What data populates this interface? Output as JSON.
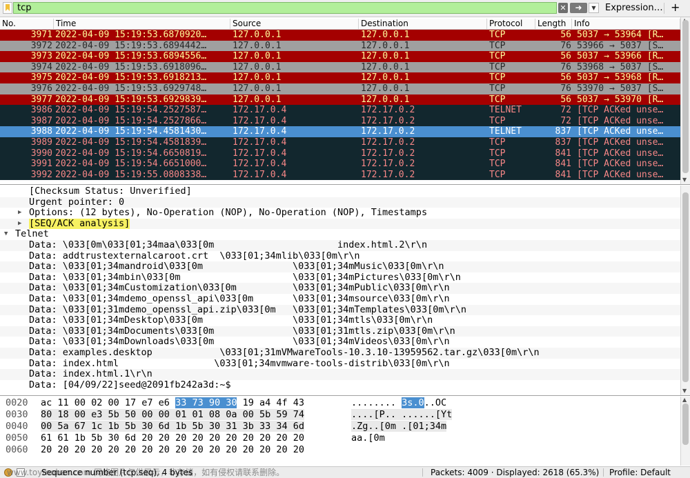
{
  "filter": {
    "value": "tcp",
    "expression_label": "Expression…",
    "add_label": "+",
    "clear_icon": "x-icon",
    "apply_icon": "arrow-right-icon"
  },
  "columns": [
    "No.",
    "Time",
    "Source",
    "Destination",
    "Protocol",
    "Length",
    "Info"
  ],
  "packets": [
    {
      "no": "3971",
      "time": "2022-04-09 15:19:53.6870920…",
      "src": "127.0.0.1",
      "dst": "127.0.0.1",
      "proto": "TCP",
      "len": "56",
      "info": "5037 → 53964 [R…",
      "style": "rst"
    },
    {
      "no": "3972",
      "time": "2022-04-09 15:19:53.6894442…",
      "src": "127.0.0.1",
      "dst": "127.0.0.1",
      "proto": "TCP",
      "len": "76",
      "info": "53966 → 5037 [S…",
      "style": "syn"
    },
    {
      "no": "3973",
      "time": "2022-04-09 15:19:53.6894556…",
      "src": "127.0.0.1",
      "dst": "127.0.0.1",
      "proto": "TCP",
      "len": "56",
      "info": "5037 → 53966 [R…",
      "style": "rst"
    },
    {
      "no": "3974",
      "time": "2022-04-09 15:19:53.6918096…",
      "src": "127.0.0.1",
      "dst": "127.0.0.1",
      "proto": "TCP",
      "len": "76",
      "info": "53968 → 5037 [S…",
      "style": "syn"
    },
    {
      "no": "3975",
      "time": "2022-04-09 15:19:53.6918213…",
      "src": "127.0.0.1",
      "dst": "127.0.0.1",
      "proto": "TCP",
      "len": "56",
      "info": "5037 → 53968 [R…",
      "style": "rst"
    },
    {
      "no": "3976",
      "time": "2022-04-09 15:19:53.6929748…",
      "src": "127.0.0.1",
      "dst": "127.0.0.1",
      "proto": "TCP",
      "len": "76",
      "info": "53970 → 5037 [S…",
      "style": "syn"
    },
    {
      "no": "3977",
      "time": "2022-04-09 15:19:53.6929839…",
      "src": "127.0.0.1",
      "dst": "127.0.0.1",
      "proto": "TCP",
      "len": "56",
      "info": "5037 → 53970 [R…",
      "style": "rst"
    },
    {
      "no": "3986",
      "time": "2022-04-09 15:19:54.2527587…",
      "src": "172.17.0.4",
      "dst": "172.17.0.2",
      "proto": "TELNET",
      "len": "72",
      "info": "[TCP ACKed unse…",
      "style": "dark"
    },
    {
      "no": "3987",
      "time": "2022-04-09 15:19:54.2527866…",
      "src": "172.17.0.4",
      "dst": "172.17.0.2",
      "proto": "TCP",
      "len": "72",
      "info": "[TCP ACKed unse…",
      "style": "dark"
    },
    {
      "no": "3988",
      "time": "2022-04-09 15:19:54.4581430…",
      "src": "172.17.0.4",
      "dst": "172.17.0.2",
      "proto": "TELNET",
      "len": "837",
      "info": "[TCP ACKed unse…",
      "style": "sel"
    },
    {
      "no": "3989",
      "time": "2022-04-09 15:19:54.4581839…",
      "src": "172.17.0.4",
      "dst": "172.17.0.2",
      "proto": "TCP",
      "len": "837",
      "info": "[TCP ACKed unse…",
      "style": "dark"
    },
    {
      "no": "3990",
      "time": "2022-04-09 15:19:54.6650819…",
      "src": "172.17.0.4",
      "dst": "172.17.0.2",
      "proto": "TCP",
      "len": "841",
      "info": "[TCP ACKed unse…",
      "style": "dark"
    },
    {
      "no": "3991",
      "time": "2022-04-09 15:19:54.6651000…",
      "src": "172.17.0.4",
      "dst": "172.17.0.2",
      "proto": "TCP",
      "len": "841",
      "info": "[TCP ACKed unse…",
      "style": "dark"
    },
    {
      "no": "3992",
      "time": "2022-04-09 15:19:55.0808338…",
      "src": "172.17.0.4",
      "dst": "172.17.0.2",
      "proto": "TCP",
      "len": "841",
      "info": "[TCP ACKed unse…",
      "style": "dark"
    }
  ],
  "details": [
    {
      "level": 2,
      "twisty": "",
      "text": "[Checksum Status: Unverified]",
      "hl": false
    },
    {
      "level": 2,
      "twisty": "",
      "text": "Urgent pointer: 0",
      "hl": false
    },
    {
      "level": 1,
      "twisty": "▶",
      "text": "Options: (12 bytes), No-Operation (NOP), No-Operation (NOP), Timestamps",
      "hl": false
    },
    {
      "level": 1,
      "twisty": "▶",
      "text": "[SEQ/ACK analysis]",
      "hl": true
    },
    {
      "level": 0,
      "twisty": "▼",
      "text": "Telnet",
      "hl": false
    },
    {
      "level": 2,
      "twisty": "",
      "text": "Data: \\033[0m\\033[01;34maa\\033[0m                      index.html.2\\r\\n",
      "hl": false
    },
    {
      "level": 2,
      "twisty": "",
      "text": "Data: addtrustexternalcaroot.crt  \\033[01;34mlib\\033[0m\\r\\n",
      "hl": false
    },
    {
      "level": 2,
      "twisty": "",
      "text": "Data: \\033[01;34mandroid\\033[0m                \\033[01;34mMusic\\033[0m\\r\\n",
      "hl": false
    },
    {
      "level": 2,
      "twisty": "",
      "text": "Data: \\033[01;34mbin\\033[0m                    \\033[01;34mPictures\\033[0m\\r\\n",
      "hl": false
    },
    {
      "level": 2,
      "twisty": "",
      "text": "Data: \\033[01;34mCustomization\\033[0m          \\033[01;34mPublic\\033[0m\\r\\n",
      "hl": false
    },
    {
      "level": 2,
      "twisty": "",
      "text": "Data: \\033[01;34mdemo_openssl_api\\033[0m       \\033[01;34msource\\033[0m\\r\\n",
      "hl": false
    },
    {
      "level": 2,
      "twisty": "",
      "text": "Data: \\033[01;31mdemo_openssl_api.zip\\033[0m   \\033[01;34mTemplates\\033[0m\\r\\n",
      "hl": false
    },
    {
      "level": 2,
      "twisty": "",
      "text": "Data: \\033[01;34mDesktop\\033[0m                \\033[01;34mtls\\033[0m\\r\\n",
      "hl": false
    },
    {
      "level": 2,
      "twisty": "",
      "text": "Data: \\033[01;34mDocuments\\033[0m              \\033[01;31mtls.zip\\033[0m\\r\\n",
      "hl": false
    },
    {
      "level": 2,
      "twisty": "",
      "text": "Data: \\033[01;34mDownloads\\033[0m              \\033[01;34mVideos\\033[0m\\r\\n",
      "hl": false
    },
    {
      "level": 2,
      "twisty": "",
      "text": "Data: examples.desktop            \\033[01;31mVMwareTools-10.3.10-13959562.tar.gz\\033[0m\\r\\n",
      "hl": false
    },
    {
      "level": 2,
      "twisty": "",
      "text": "Data: index.html                 \\033[01;34mvmware-tools-distrib\\033[0m\\r\\n",
      "hl": false
    },
    {
      "level": 2,
      "twisty": "",
      "text": "Data: index.html.1\\r\\n",
      "hl": false
    },
    {
      "level": 2,
      "twisty": "",
      "text": "Data: [04/09/22]seed@2091fb242a3d:~$",
      "hl": false
    }
  ],
  "bytes": [
    {
      "off": "0020",
      "hex": [
        [
          "ac 11 00 02 00 17 e7 e6 ",
          ""
        ],
        [
          "33 73 90 30",
          "sel"
        ],
        [
          " 19 a4 4f 43",
          ""
        ]
      ],
      "ascii": [
        [
          "........ ",
          ""
        ],
        [
          "3s.0",
          "sel"
        ],
        [
          "..OC",
          ""
        ]
      ]
    },
    {
      "off": "0030",
      "hex": [
        [
          "80 18 00 e3 5b 50 00 00 01 01 08 0a 00 5b 59 74",
          "shade"
        ]
      ],
      "ascii": [
        [
          "....[P.. ......[Yt",
          "shade"
        ]
      ]
    },
    {
      "off": "0040",
      "hex": [
        [
          "00 5a 67 1c 1b 5b 30 6d 1b 5b 30 31 3b 33 34 6d",
          "shade"
        ]
      ],
      "ascii": [
        [
          ".Zg..[0m .[01;34m",
          "shade"
        ]
      ]
    },
    {
      "off": "0050",
      "hex": [
        [
          "61 61 1b 5b 30 6d 20 20 20 20 20 20 20 20 20 20",
          ""
        ]
      ],
      "ascii": [
        [
          "aa.[0m",
          ""
        ]
      ]
    },
    {
      "off": "0060",
      "hex": [
        [
          "20 20 20 20 20 20 20 20 20 20 20 20 20 20 20 20",
          ""
        ]
      ],
      "ascii": [
        [
          "",
          ""
        ]
      ]
    }
  ],
  "status": {
    "field": "Sequence number (tcp.seq), 4 bytes",
    "watermark": "www.toymoban.com 网络图片仅供展示，非存储，如有侵权请联系删除。",
    "packets": "Packets: 4009 · Displayed: 2618 (65.3%)",
    "profile": "Profile: Default"
  },
  "colors": {
    "filter_ok": "#b2ef9a",
    "rst_bg": "#a40000",
    "rst_fg": "#fffc9c",
    "syn_bg": "#a0a0a0",
    "dark_bg": "#12272e",
    "dark_fg": "#f78787",
    "selected_bg": "#4a8fd0",
    "highlight": "#f7f162"
  }
}
